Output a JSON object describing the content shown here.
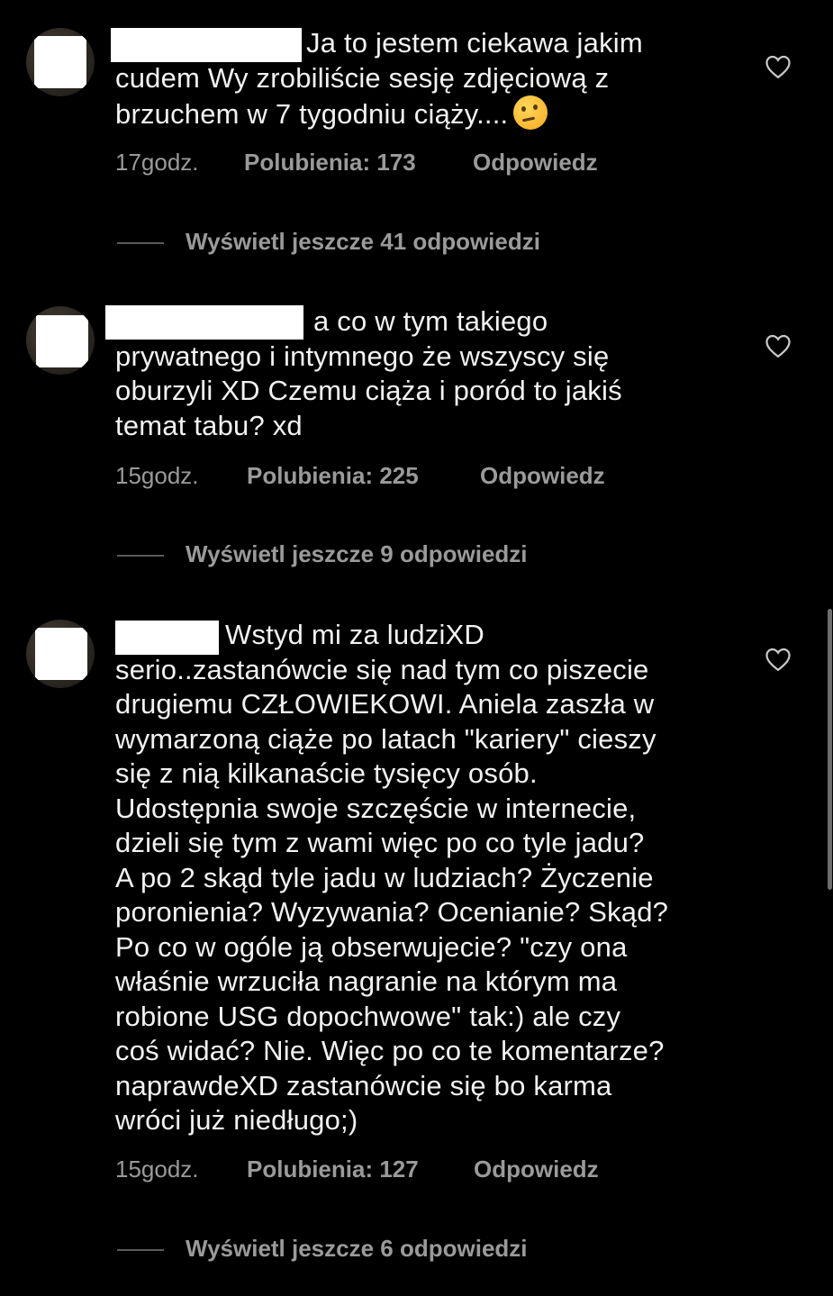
{
  "comments": [
    {
      "text_first_line": "Ja to jestem ciekawa jakim",
      "text_rest": "cudem Wy zrobiliście sesję zdjęciową z\nbrzuchem w 7 tygodniu ciąży....",
      "emoji": "thinking-face",
      "time": "17godz.",
      "likes": "Polubienia: 173",
      "reply": "Odpowiedz",
      "view_more": "Wyświetl jeszcze 41 odpowiedzi"
    },
    {
      "text_first_line": "a co w tym takiego",
      "text_rest": "prywatnego i intymnego że wszyscy się\noburzyli XD Czemu ciąża i poród to jakiś\ntemat tabu? xd",
      "time": "15godz.",
      "likes": "Polubienia: 225",
      "reply": "Odpowiedz",
      "view_more": "Wyświetl jeszcze 9 odpowiedzi"
    },
    {
      "text_first_line": "Wstyd mi za ludziXD",
      "text_rest": "serio..zastanówcie się nad tym co piszecie\ndrugiemu CZŁOWIEKOWI. Aniela zaszła w\nwymarzoną ciąże po latach \"kariery\" cieszy\nsię z nią kilkanaście tysięcy osób.\nUdostępnia swoje szczęście w internecie,\ndzieli się tym z wami więc po co tyle jadu?\nA po 2 skąd tyle jadu w ludziach? Życzenie\nporonienia? Wyzywania? Ocenianie? Skąd?\nPo co w ogóle ją obserwujecie? \"czy ona\nwłaśnie wrzuciła nagranie na którym ma\nrobione USG dopochwowe\" tak:) ale czy\ncoś widać? Nie. Więc po co te komentarze?\nnaprawdeXD zastanówcie się bo karma\nwróci już niedługo;)",
      "time": "15godz.",
      "likes": "Polubienia: 127",
      "reply": "Odpowiedz",
      "view_more": "Wyświetl jeszcze 6 odpowiedzi"
    }
  ],
  "icons": {
    "like": "heart-outline-icon",
    "avatar": "avatar-redacted"
  },
  "colors": {
    "background": "#000000",
    "text": "#f2f2f2",
    "meta": "#9a9a9a"
  }
}
